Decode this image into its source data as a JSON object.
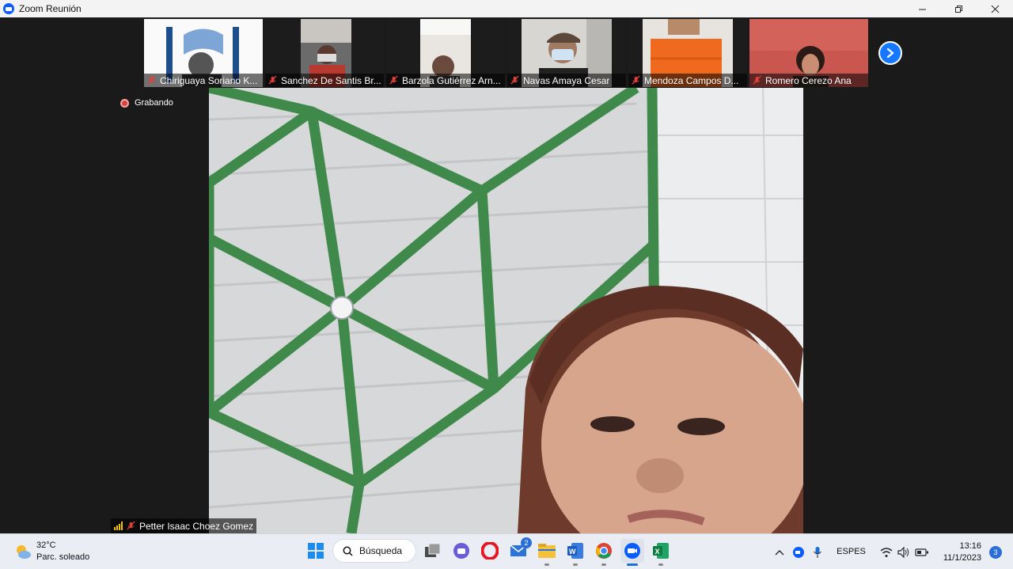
{
  "window": {
    "title": "Zoom Reunión"
  },
  "participants": [
    {
      "name": "Chiriguaya Soriano K..."
    },
    {
      "name": "Sanchez De Santis Br..."
    },
    {
      "name": "Barzola Gutiérrez Arn..."
    },
    {
      "name": "Navas Amaya Cesar"
    },
    {
      "name": "Mendoza Campos D..."
    },
    {
      "name": "Romero Cerezo Ana"
    }
  ],
  "recording": {
    "label": "Grabando"
  },
  "active_speaker": {
    "name": "Petter Isaac Choez Gomez"
  },
  "taskbar": {
    "weather": {
      "temp": "32°C",
      "condition": "Parc. soleado"
    },
    "search_label": "Búsqueda",
    "mail_badge": "2",
    "language": {
      "line1": "ESP",
      "line2": "ES"
    },
    "time": "13:16",
    "date": "11/1/2023",
    "notification_count": "3"
  },
  "icons": [
    "windows-start-icon",
    "search-icon",
    "task-view-icon",
    "teams-chat-icon",
    "opera-icon",
    "mail-icon",
    "file-explorer-icon",
    "word-icon",
    "chrome-icon",
    "zoom-icon",
    "excel-icon"
  ],
  "colors": {
    "zoom_blue": "#0b5cff",
    "mute_red": "#e0413b",
    "accent": "#1479ff"
  }
}
